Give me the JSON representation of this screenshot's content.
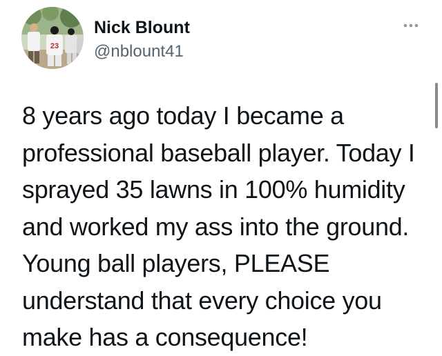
{
  "author": {
    "display_name": "Nick Blount",
    "handle": "@nblount41",
    "avatar_jersey_number": "23"
  },
  "tweet": {
    "lines": [
      "8 years ago today I became a",
      "professional baseball player. Today I",
      "sprayed 35 lawns in 100% humidity",
      "and worked my ass into the ground.",
      "Young ball players, PLEASE",
      "understand that every choice you",
      "make has a consequence!"
    ]
  },
  "icons": {
    "more": "more-options-icon"
  },
  "colors": {
    "text": "#0f1419",
    "secondary_text": "#536471",
    "background": "#ffffff"
  }
}
